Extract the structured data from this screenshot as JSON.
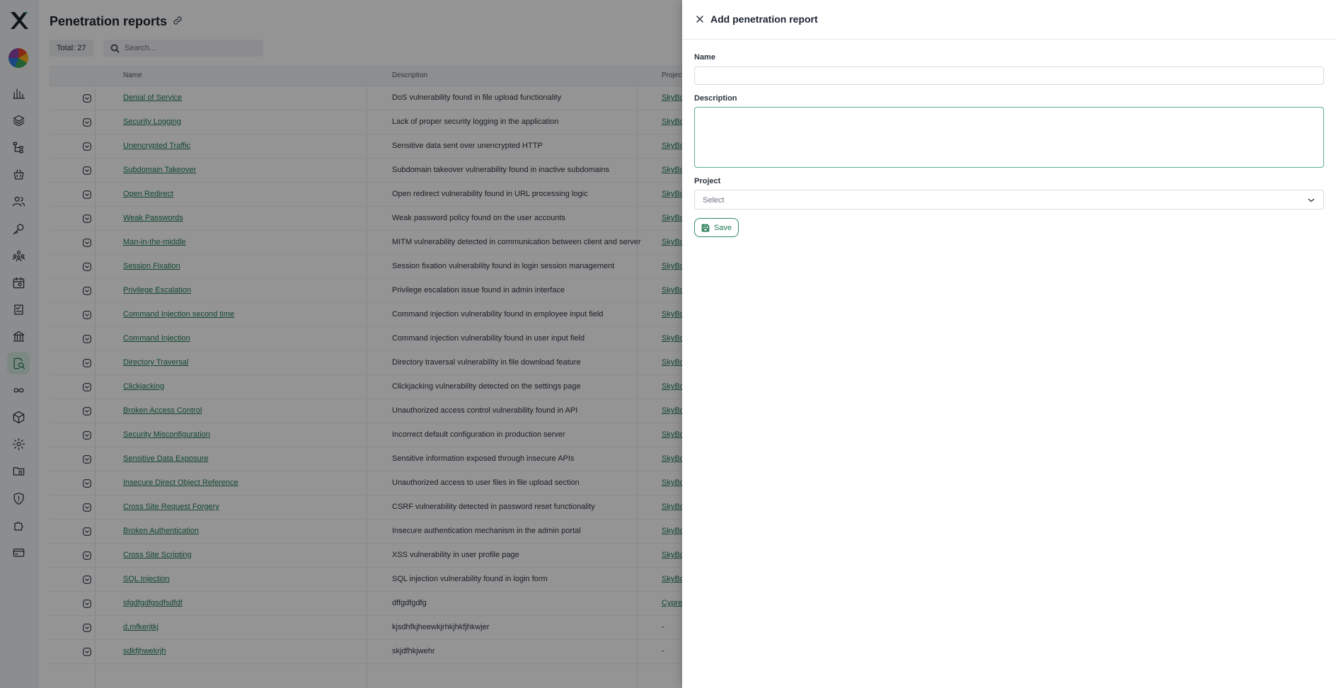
{
  "header": {
    "title": "Penetration reports",
    "total": "Total: 27"
  },
  "search": {
    "placeholder": "Search..."
  },
  "table": {
    "columns": [
      "Name",
      "Description",
      "Project"
    ],
    "rows": [
      {
        "name": "Denial of Service",
        "description": "DoS vulnerability found in file upload functionality",
        "project": "SkyBo"
      },
      {
        "name": "Security Logging",
        "description": "Lack of proper security logging in the application",
        "project": "SkyBo"
      },
      {
        "name": "Unencrypted Traffic",
        "description": "Sensitive data sent over unencrypted HTTP",
        "project": "SkyBo"
      },
      {
        "name": "Subdomain Takeover",
        "description": "Subdomain takeover vulnerability found in inactive subdomains",
        "project": "SkyBo"
      },
      {
        "name": "Open Redirect",
        "description": "Open redirect vulnerability found in URL processing logic",
        "project": "SkyBo"
      },
      {
        "name": "Weak Passwords",
        "description": "Weak password policy found on the user accounts",
        "project": "SkyBo"
      },
      {
        "name": "Man-in-the-middle",
        "description": "MITM vulnerability detected in communication between client and server",
        "project": "SkyBo"
      },
      {
        "name": "Session Fixation",
        "description": "Session fixation vulnerability found in login session management",
        "project": "SkyBo"
      },
      {
        "name": "Privilege Escalation",
        "description": "Privilege escalation issue found in admin interface",
        "project": "SkyBo"
      },
      {
        "name": "Command Injection second time",
        "description": "Command injection vulnerability found in employee input field",
        "project": "SkyBo"
      },
      {
        "name": "Command Injection",
        "description": "Command injection vulnerability found in user input field",
        "project": "SkyBo"
      },
      {
        "name": "Directory Traversal",
        "description": "Directory traversal vulnerability in file download feature",
        "project": "SkyBo"
      },
      {
        "name": "Clickjacking",
        "description": "Clickjacking vulnerability detected on the settings page",
        "project": "SkyBo"
      },
      {
        "name": "Broken Access Control",
        "description": "Unauthorized access control vulnerability found in API",
        "project": "SkyBo"
      },
      {
        "name": "Security Misconfiguration",
        "description": "Incorrect default configuration in production server",
        "project": "SkyBo"
      },
      {
        "name": "Sensitive Data Exposure",
        "description": "Sensitive information exposed through insecure APIs",
        "project": "SkyBo"
      },
      {
        "name": "Insecure Direct Object Reference",
        "description": "Unauthorized access to user files in file upload section",
        "project": "SkyBo"
      },
      {
        "name": "Cross Site Request Forgery",
        "description": "CSRF vulnerability detected in password reset functionality",
        "project": "SkyBo"
      },
      {
        "name": "Broken Authentication",
        "description": "Insecure authentication mechanism in the admin portal",
        "project": "SkyBo"
      },
      {
        "name": "Cross Site Scripting",
        "description": "XSS vulnerability in user profile page",
        "project": "SkyBo"
      },
      {
        "name": "SQL Injection",
        "description": "SQL injection vulnerability found in login form",
        "project": "SkyBo"
      },
      {
        "name": "sfgdfgdfgsdfsdfdf",
        "description": "dffgdfgdfg",
        "project": "Cypre"
      },
      {
        "name": "d,mfkerjtkj",
        "description": "kjsdhfkjheewkjrhkjhkfjhkwjer",
        "project": "-"
      },
      {
        "name": "sdkfjhwekrjh",
        "description": "skjdfhkjwehr",
        "project": "-"
      }
    ]
  },
  "drawer": {
    "title": "Add penetration report",
    "name_label": "Name",
    "description_label": "Description",
    "project_label": "Project",
    "project_placeholder": "Select",
    "save_label": "Save"
  },
  "sidebar": {
    "items": [
      "bar-chart-icon",
      "layers-icon",
      "hierarchy-icon",
      "basket-icon",
      "users-icon",
      "key-icon",
      "team-icon",
      "calendar-icon",
      "checklist-icon",
      "bank-icon",
      "penetration-icon",
      "infinity-icon",
      "cube-icon",
      "settings-icon",
      "folder-icon",
      "shield-icon",
      "puzzle-icon",
      "card-icon"
    ],
    "active": "penetration-icon"
  },
  "colors": {
    "accent": "#1e7a53",
    "active_bg": "#d6ece2"
  }
}
